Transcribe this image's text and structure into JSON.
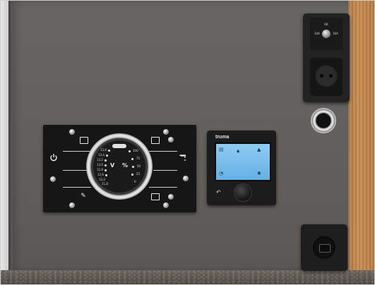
{
  "scene": {
    "panel": {
      "gauge_ticks_left": [
        "13,6",
        "13,4",
        "13,2",
        "13,0",
        "12,8",
        "12,6",
        "12,0",
        "11,8"
      ],
      "gauge_ticks_right": [
        "100",
        "75",
        "50",
        "25",
        "0"
      ],
      "gauge_label_volt": "V",
      "gauge_label_percent": "%"
    },
    "thermostat": {
      "brand": "truma"
    },
    "socket_module": {
      "switch_label_left": "10A",
      "switch_label_right": "16A",
      "switch_label_top": "OK"
    },
    "icons": [
      "power-icon",
      "tap-icon",
      "lamp-icon",
      "back-arrow-icon",
      "key-icon"
    ]
  }
}
